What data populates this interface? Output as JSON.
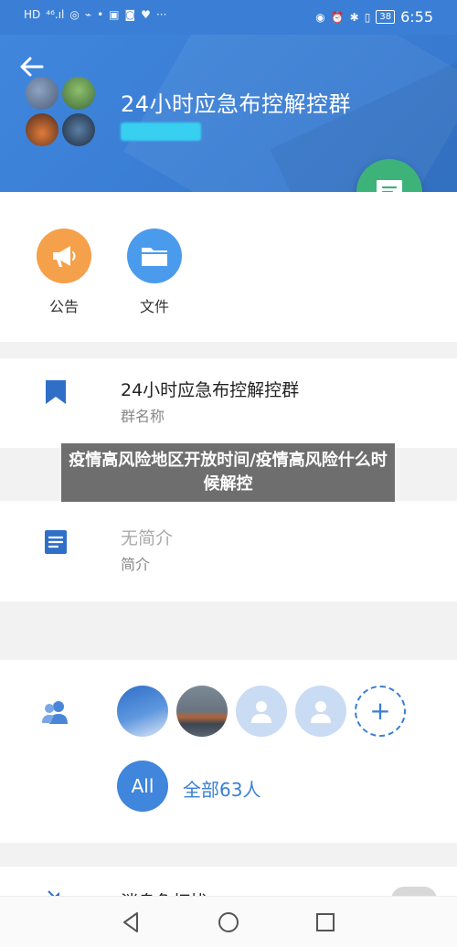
{
  "status_bar": {
    "left_indicators": [
      "HD",
      "⁴⁶.ıl",
      "◎",
      "⌁",
      "•",
      "▣",
      "◙",
      "♥",
      "···"
    ],
    "right_indicators": [
      "◉",
      "⏰",
      "✱",
      "▯"
    ],
    "battery": "38",
    "time": "6:55"
  },
  "header": {
    "title": "24小时应急布控解控群"
  },
  "quick_actions": [
    {
      "label": "公告",
      "icon": "megaphone-icon",
      "color": "#f5a04a"
    },
    {
      "label": "文件",
      "icon": "folder-icon",
      "color": "#4a9bec"
    }
  ],
  "group_name": {
    "value": "24小时应急布控解控群",
    "caption": "群名称"
  },
  "overlay": {
    "text": "疫情高风险地区开放时间/疫情高风险什么时候解控"
  },
  "intro": {
    "value": "无简介",
    "caption": "简介"
  },
  "members": {
    "add_symbol": "+",
    "all_badge": "All",
    "count_label": "全部63人"
  },
  "notification": {
    "label": "消息免打扰"
  },
  "colors": {
    "primary": "#3a7fd5",
    "chat_fab": "#3db37a"
  }
}
